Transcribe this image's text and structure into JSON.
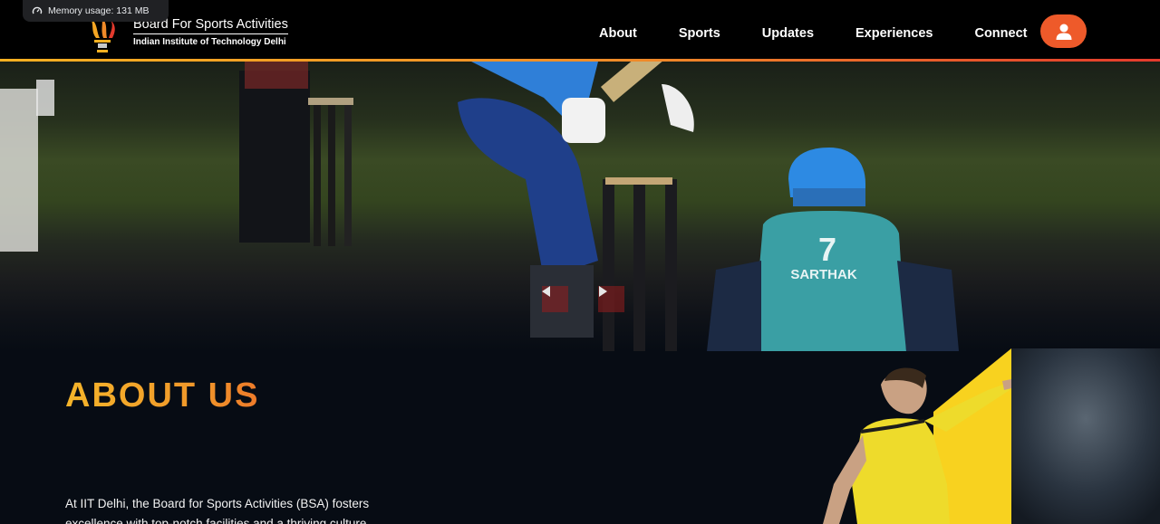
{
  "system": {
    "memory_usage": "Memory usage: 131 MB",
    "memory_icon": "gauge-icon"
  },
  "brand": {
    "title": "Board For Sports Activities",
    "subtitle": "Indian Institute of Technology Delhi",
    "logo_icon": "torch-logo-icon"
  },
  "nav": {
    "items": [
      {
        "label": "About"
      },
      {
        "label": "Sports"
      },
      {
        "label": "Updates"
      },
      {
        "label": "Experiences"
      },
      {
        "label": "Connect"
      }
    ],
    "profile_icon": "user-icon",
    "accent": "#ee5a2a"
  },
  "hero": {
    "jersey_name": "SARTHAK",
    "jersey_number": "7",
    "prev_icon": "triangle-left-icon",
    "next_icon": "triangle-right-icon"
  },
  "about": {
    "title": "ABOUT US",
    "text": "At IIT Delhi, the Board for Sports Activities (BSA) fosters excellence with top-notch facilities and a thriving culture"
  },
  "colors": {
    "background": "#070c14",
    "gradient_start": "#f5b021",
    "gradient_end": "#e33a2d",
    "art_yellow": "#f8d21f"
  }
}
